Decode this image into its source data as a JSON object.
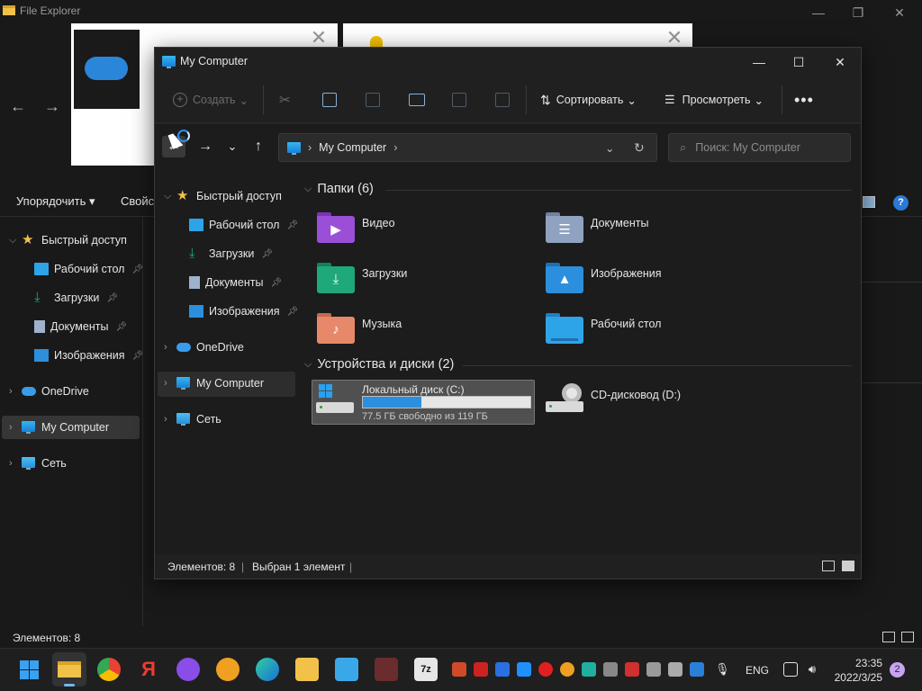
{
  "background": {
    "title": "File Explorer",
    "command_sort": "Упорядочить ▾",
    "command_props": "Свойст",
    "sidebar": [
      {
        "label": "Быстрый доступ"
      },
      {
        "label": "Рабочий стол",
        "pinned": true
      },
      {
        "label": "Загрузки",
        "pinned": true
      },
      {
        "label": "Документы",
        "pinned": true
      },
      {
        "label": "Изображения",
        "pinned": true
      },
      {
        "label": "OneDrive"
      },
      {
        "label": "My Computer"
      },
      {
        "label": "Сеть"
      }
    ],
    "status": "Элементов: 8"
  },
  "window": {
    "title": "My Computer",
    "toolbar": {
      "new_label": "Создать",
      "sort_label": "Сортировать",
      "view_label": "Просмотреть"
    },
    "address": {
      "path": "My Computer",
      "search_placeholder": "Поиск: My Computer"
    },
    "nav": [
      {
        "label": "Быстрый доступ"
      },
      {
        "label": "Рабочий стол",
        "pinned": true
      },
      {
        "label": "Загрузки",
        "pinned": true
      },
      {
        "label": "Документы",
        "pinned": true
      },
      {
        "label": "Изображения",
        "pinned": true
      },
      {
        "label": "OneDrive"
      },
      {
        "label": "My Computer"
      },
      {
        "label": "Сеть"
      }
    ],
    "folders_group": "Папки (6)",
    "folders": [
      {
        "label": "Видео",
        "color": "#9b4fd6",
        "glyph": "▶"
      },
      {
        "label": "Документы",
        "color": "#8fa3c0",
        "glyph": "☰"
      },
      {
        "label": "Загрузки",
        "color": "#1fa87a",
        "glyph": "⬇"
      },
      {
        "label": "Изображения",
        "color": "#2b8fde",
        "glyph": "▲"
      },
      {
        "label": "Музыка",
        "color": "#e8886a",
        "glyph": "♪"
      },
      {
        "label": "Рабочий стол",
        "color": "#2ea4e8",
        "glyph": ""
      }
    ],
    "devices_group": "Устройства и диски (2)",
    "drives": [
      {
        "label": "Локальный диск (C:)",
        "free": "77.5 ГБ свободно из 119 ГБ",
        "used_fraction": 0.35
      },
      {
        "label": "CD-дисковод (D:)"
      }
    ],
    "status": {
      "count": "Элементов: 8",
      "selected": "Выбран 1 элемент"
    }
  },
  "taskbar": {
    "lang": "ENG",
    "time": "23:35",
    "date": "2022/3/25",
    "notifications": "2"
  }
}
